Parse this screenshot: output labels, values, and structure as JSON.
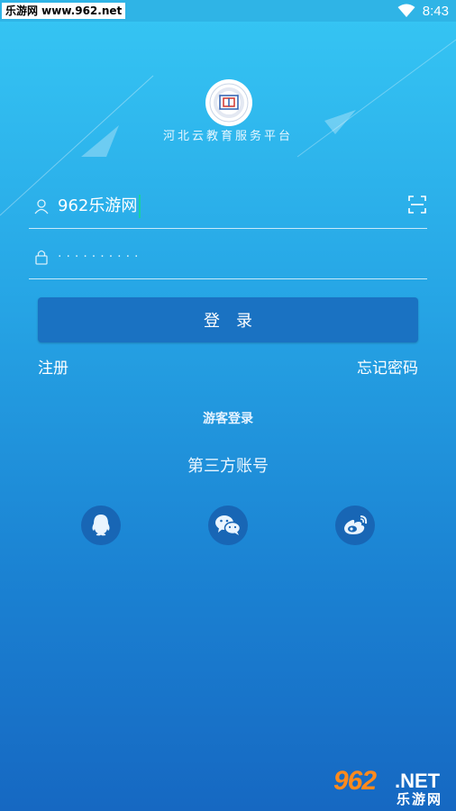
{
  "status_bar": {
    "watermark": "乐游网 www.962.net",
    "time": "8:43"
  },
  "header": {
    "logo_icon": "school-seal-logo",
    "platform_name": "河北云教育服务平台"
  },
  "form": {
    "username": "962乐游网",
    "password_mask": "··········",
    "login_label": "登录",
    "register_label": "注册",
    "forgot_label": "忘记密码",
    "guest_label": "游客登录",
    "third_party_label": "第三方账号"
  },
  "social": [
    {
      "icon": "qq-icon"
    },
    {
      "icon": "wechat-icon"
    },
    {
      "icon": "weibo-icon"
    }
  ],
  "watermark": {
    "number": "962",
    "net": ".NET",
    "cn": "乐游网"
  },
  "colors": {
    "bg_top": "#36c6f4",
    "bg_bottom": "#1668c2",
    "button": "#1a72c2",
    "social_bg": "#1866b5",
    "accent_cursor": "#1ad1a0"
  }
}
